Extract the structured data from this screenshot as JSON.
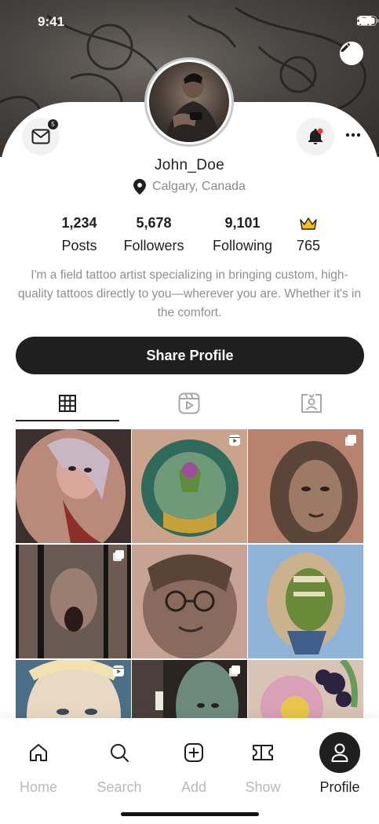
{
  "status_bar": {
    "time": "9:41"
  },
  "profile": {
    "username": "John_Doe",
    "location": "Calgary, Canada",
    "messages_badge": "5"
  },
  "stats": [
    {
      "value": "1,234",
      "label": "Posts"
    },
    {
      "value": "5,678",
      "label": "Followers"
    },
    {
      "value": "9,101",
      "label": "Following"
    },
    {
      "value": "",
      "label": "765",
      "icon": "crown-icon"
    }
  ],
  "bio": "I'm a field tattoo artist specializing in bringing custom, high-quality tattoos directly to you—wherever you are. Whether it's in the comfort.",
  "share_button": "Share Profile",
  "tabs": [
    {
      "icon": "grid-icon",
      "active": true
    },
    {
      "icon": "reels-icon",
      "active": false
    },
    {
      "icon": "tagged-icon",
      "active": false
    }
  ],
  "posts": [
    {
      "icon": ""
    },
    {
      "icon": "reel-icon"
    },
    {
      "icon": "multi-icon"
    },
    {
      "icon": "multi-icon"
    },
    {
      "icon": ""
    },
    {
      "icon": ""
    },
    {
      "icon": "reel-icon"
    },
    {
      "icon": "multi-icon"
    },
    {
      "icon": ""
    }
  ],
  "bottom_nav": [
    {
      "label": "Home",
      "icon": "home-icon",
      "active": false
    },
    {
      "label": "Search",
      "icon": "search-icon",
      "active": false
    },
    {
      "label": "Add",
      "icon": "add-icon",
      "active": false
    },
    {
      "label": "Show",
      "icon": "ticket-icon",
      "active": false
    },
    {
      "label": "Profile",
      "icon": "person-icon",
      "active": true
    }
  ],
  "colors": {
    "accent": "#1f1f1f",
    "crown": "#f2c20c",
    "notification_dot": "#e23c3c"
  }
}
